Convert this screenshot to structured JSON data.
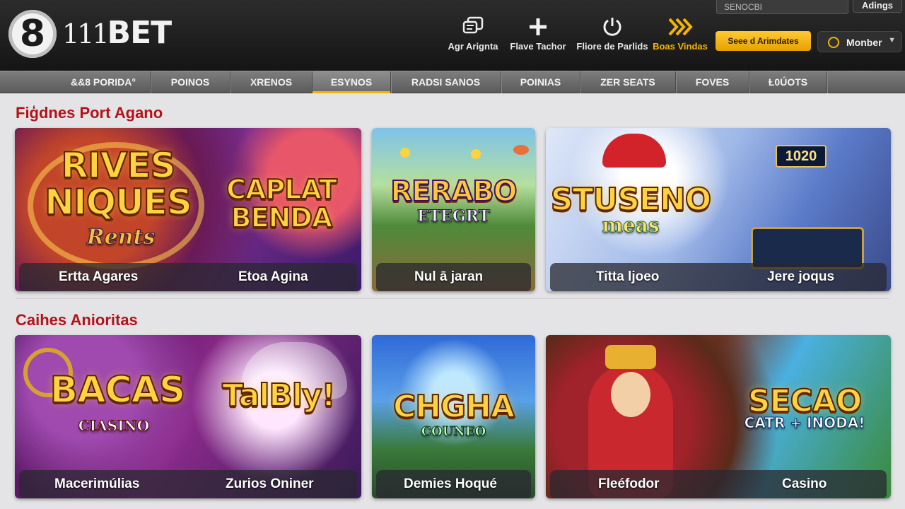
{
  "brand": {
    "mark": "8",
    "name_num": "111",
    "name_text": "BET"
  },
  "header": {
    "search_placeholder": "SENOCBI",
    "admin_label": "Adings",
    "promo_label": "Seee d Arimdates",
    "member_label": "Monber",
    "quick_links": [
      {
        "label": "Agr Arignta",
        "icon": "chat-icon"
      },
      {
        "label": "Flave Tachor",
        "icon": "plus-icon"
      },
      {
        "label": "Fliore de Parlids",
        "icon": "power-icon"
      },
      {
        "label": "Boas Vindas",
        "icon": "fast-forward-icon"
      }
    ],
    "accent": "#f4b400"
  },
  "nav": {
    "items": [
      "&&8 PORIDA°",
      "POINOS",
      "XRENOS",
      "ESYNOS",
      "RADSI SANOS",
      "POINIAS",
      "ZER SEATS",
      "FOVES",
      "Ƚ0ÚOTS"
    ],
    "active_index": 3
  },
  "sections": [
    {
      "title": "Fiģdnes Port Agano",
      "cards": [
        {
          "art_lines": [
            "RIVES",
            "NIQUES"
          ],
          "art_sub": "Rents",
          "art2_lines": [
            "CAPLAT",
            "BENDA"
          ],
          "captions": [
            "Ertta Agares",
            "Etoa Agina"
          ]
        },
        {
          "art_lines": [
            "RERABO"
          ],
          "art_sub": "ETEGRT",
          "captions": [
            "Nul ā jaran"
          ]
        },
        {
          "art_lines": [
            "STUSENO"
          ],
          "art_sub": "meas",
          "score": "1020",
          "captions": [
            "Titta ljoeo",
            "Jere joqus"
          ]
        }
      ]
    },
    {
      "title": "Caihes Anioritas",
      "cards": [
        {
          "art_lines": [
            "BACAS"
          ],
          "art_sub": "CIASINO",
          "art2_lines": [
            "TalBly!"
          ],
          "captions": [
            "Macerimúlias",
            "Zurios Oniner"
          ]
        },
        {
          "art_lines": [
            "CHGHA"
          ],
          "art_sub": "COUNEO",
          "captions": [
            "Demies Hoqué"
          ]
        },
        {
          "art_lines": [
            "SECAO"
          ],
          "art_sub": "CATR + INODA!",
          "captions": [
            "Fleéfodor",
            "Casino"
          ]
        }
      ]
    }
  ]
}
